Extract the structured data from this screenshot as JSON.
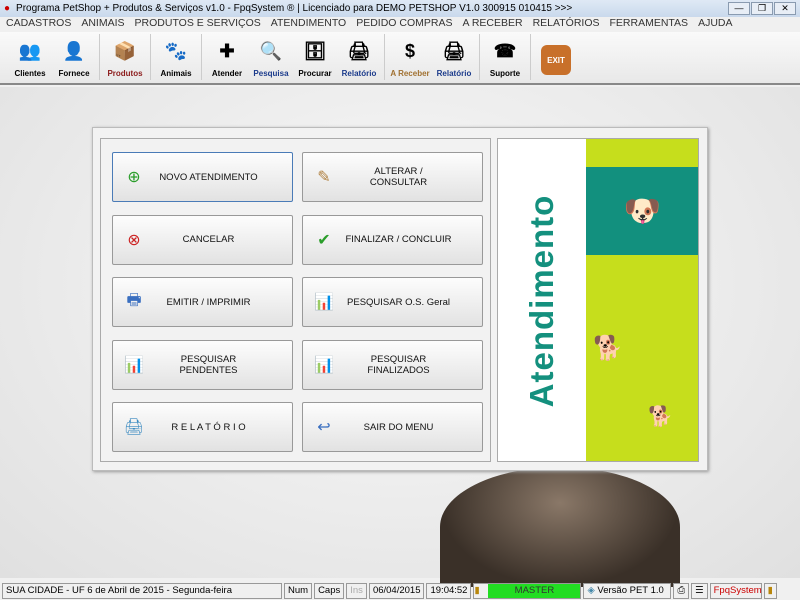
{
  "window": {
    "title": "Programa PetShop + Produtos & Serviços v1.0 - FpqSystem ® | Licenciado para  DEMO PETSHOP V1.0 300915 010415 >>>"
  },
  "menu": [
    "CADASTROS",
    "ANIMAIS",
    "PRODUTOS E SERVIÇOS",
    "ATENDIMENTO",
    "PEDIDO COMPRAS",
    "A RECEBER",
    "RELATÓRIOS",
    "FERRAMENTAS",
    "AJUDA"
  ],
  "toolbar": [
    {
      "label": "Clientes",
      "color": "#000",
      "icon": "👥"
    },
    {
      "label": "Fornece",
      "color": "#000",
      "icon": "👤"
    },
    {
      "label": "Produtos",
      "color": "#8b1a1a",
      "icon": "📦"
    },
    {
      "label": "Animais",
      "color": "#000",
      "icon": "🐾"
    },
    {
      "label": "Atender",
      "color": "#000",
      "icon": "✚"
    },
    {
      "label": "Pesquisa",
      "color": "#1a3a8b",
      "icon": "🔍"
    },
    {
      "label": "Procurar",
      "color": "#000",
      "icon": "🗄"
    },
    {
      "label": "Relatório",
      "color": "#1a3a8b",
      "icon": "🖨"
    },
    {
      "label": "A Receber",
      "color": "#a07030",
      "icon": "$"
    },
    {
      "label": "Relatório",
      "color": "#1a3a8b",
      "icon": "🖨"
    },
    {
      "label": "Suporte",
      "color": "#000",
      "icon": "☎"
    },
    {
      "label": "",
      "color": "#000",
      "icon": "EXIT"
    }
  ],
  "buttons": [
    {
      "label": "NOVO ATENDIMENTO",
      "icon": "page-add-icon",
      "glyph": "⊕"
    },
    {
      "label": "ALTERAR  /  CONSULTAR",
      "icon": "pencil-icon",
      "glyph": "✎"
    },
    {
      "label": "CANCELAR",
      "icon": "page-cancel-icon",
      "glyph": "⊗"
    },
    {
      "label": "FINALIZAR  /  CONCLUIR",
      "icon": "page-check-icon",
      "glyph": "✔"
    },
    {
      "label": "EMITIR  /  IMPRIMIR",
      "icon": "print-person-icon",
      "glyph": "🖶"
    },
    {
      "label": "PESQUISAR O.S. Geral",
      "icon": "chart-search-icon",
      "glyph": "📊"
    },
    {
      "label": "PESQUISAR PENDENTES",
      "icon": "chart-search-icon",
      "glyph": "📊"
    },
    {
      "label": "PESQUISAR FINALIZADOS",
      "icon": "chart-search-icon",
      "glyph": "📊"
    },
    {
      "label": "R E L A T Ó R I O",
      "icon": "printer-icon",
      "glyph": "🖨"
    },
    {
      "label": "SAIR DO MENU",
      "icon": "exit-icon",
      "glyph": "↩"
    }
  ],
  "side_panel": {
    "title": "Atendimento"
  },
  "status": {
    "location": "SUA CIDADE - UF  6 de Abril de 2015 - Segunda-feira",
    "num": "Num",
    "caps": "Caps",
    "ins": "Ins",
    "date": "06/04/2015",
    "time": "19:04:52",
    "user": "MASTER",
    "version": "Versão PET 1.0",
    "brand": "FpqSystem",
    "user_color": "#22dd22"
  }
}
